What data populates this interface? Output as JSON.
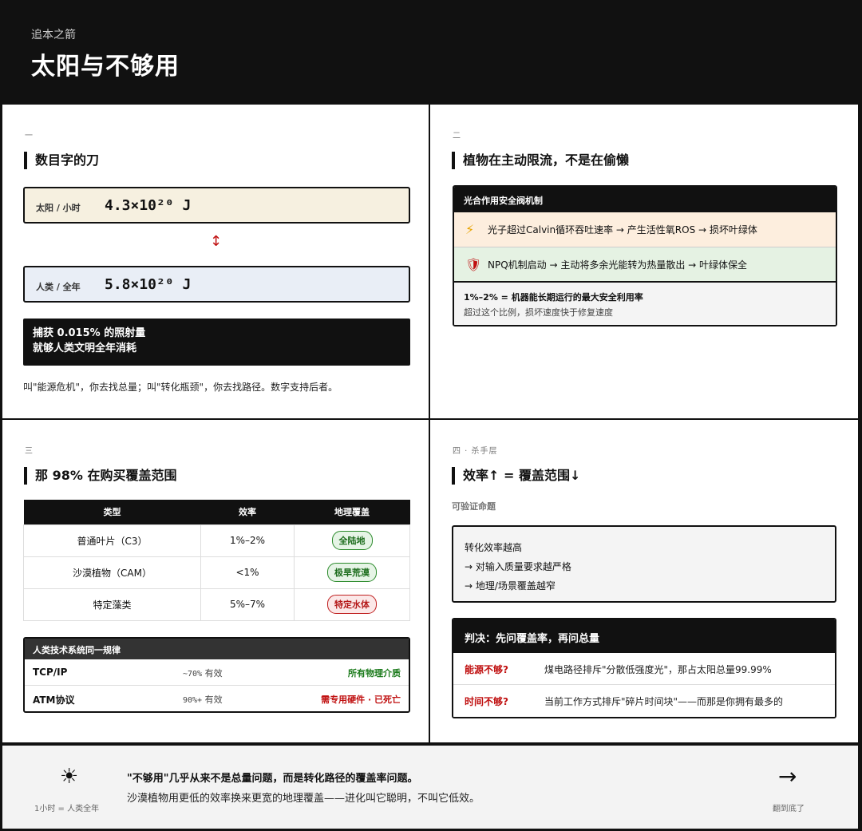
{
  "header": {
    "kicker": "追本之箭",
    "title": "太阳与不够用"
  },
  "section1": {
    "num": "一",
    "title": "数目字的刀",
    "sun": {
      "label": "太阳 / 小时",
      "value": "4.3×10²⁰ J"
    },
    "arrow": "↕",
    "human": {
      "label": "人类 / 全年",
      "value": "5.8×10²⁰ J"
    },
    "dark_line1": "捕获 0.015% 的照射量",
    "dark_line2": "就够人类文明全年消耗",
    "note": "叫\"能源危机\"，你去找总量；叫\"转化瓶颈\"，你去找路径。数字支持后者。"
  },
  "section2": {
    "num": "二",
    "title": "植物在主动限流，不是在偷懒",
    "card_head": "光合作用安全阀机制",
    "rows": [
      {
        "icon": "⚡",
        "text": "光子超过Calvin循环吞吐速率 → 产生活性氧ROS → 损坏叶绿体"
      },
      {
        "icon": "🛡",
        "text": "NPQ机制启动 → 主动将多余光能转为热量散出 → 叶绿体保全"
      }
    ],
    "foot_a": "1%–2% = 机器能长期运行的最大安全利用率",
    "foot_b": "超过这个比例，损坏速度快于修复速度"
  },
  "section3": {
    "num": "三",
    "title": "那 98% 在购买覆盖范围",
    "headers": [
      "类型",
      "效率",
      "地理覆盖"
    ],
    "rows": [
      {
        "type": "普通叶片（C3）",
        "eff": "1%–2%",
        "cov": "全陆地",
        "tone": "g"
      },
      {
        "type": "沙漠植物（CAM）",
        "eff": "<1%",
        "cov": "极旱荒漠",
        "tone": "g"
      },
      {
        "type": "特定藻类",
        "eff": "5%–7%",
        "cov": "特定水体",
        "tone": "r"
      }
    ],
    "law_head": "人类技术系统同一规律",
    "law_rows": [
      {
        "name": "TCP/IP",
        "eff_num": "~70%",
        "eff_word": "有效",
        "cov": "所有物理介质",
        "color": "#1a7a1a"
      },
      {
        "name": "ATM协议",
        "eff_num": "90%+",
        "eff_word": "有效",
        "cov": "需专用硬件 · 已死亡",
        "color": "#c01010"
      }
    ]
  },
  "section4": {
    "num": "四 · 杀手层",
    "title": "效率↑ = 覆盖范围↓",
    "sub": "可验证命题",
    "prop": [
      "转化效率越高",
      "→ 对输入质量要求越严格",
      "→ 地理/场景覆盖越窄"
    ],
    "verdict_head": "判决：先问覆盖率，再问总量",
    "verdict_rows": [
      {
        "q": "能源不够?",
        "a": "煤电路径排斥\"分散低强度光\"，那占太阳总量99.99%"
      },
      {
        "q": "时间不够?",
        "a": "当前工作方式排斥\"碎片时间块\"——而那是你拥有最多的"
      }
    ]
  },
  "footer": {
    "sun_icon": "☀",
    "sun_cap": "1小时 = 人类全年",
    "main": "\"不够用\"几乎从来不是总量问题，而是转化路径的覆盖率问题。",
    "sub": "沙漠植物用更低的效率换来更宽的地理覆盖——进化叫它聪明，不叫它低效。",
    "arrow": "→",
    "arrow_cap": "翻到底了"
  },
  "colors": {
    "accent_red": "#c01010",
    "green": "#1a7a1a",
    "dark": "#111111"
  }
}
